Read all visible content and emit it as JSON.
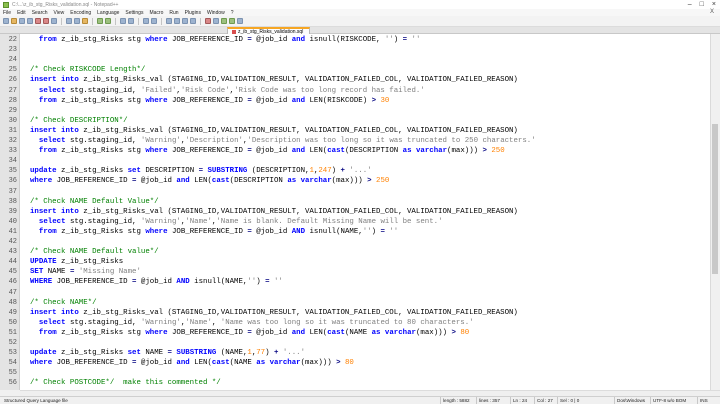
{
  "window": {
    "title": "C:\\...\\z_ib_stg_Risks_validation.sql - Notepad++",
    "minimize": "–",
    "maximize": "□",
    "close": "×"
  },
  "menu": [
    "File",
    "Edit",
    "Search",
    "View",
    "Encoding",
    "Language",
    "Settings",
    "Macro",
    "Run",
    "Plugins",
    "Window",
    "?"
  ],
  "menu_close": "X",
  "tab": {
    "label": "z_ib_stg_Risks_validation.sql"
  },
  "editor": {
    "lines": [
      {
        "n": "22",
        "html": "<span class=\"kw\">from</span> z_ib_stg_Risks stg <span class=\"kw\">where</span> JOB_REFERENCE_ID <span class=\"op\">=</span> @job_id <span class=\"kw\">and</span> isnull(RISKCODE, <span class=\"st\">''</span>) <span class=\"op\">=</span> <span class=\"st\">''</span>",
        "indent": 1
      },
      {
        "n": "23",
        "html": "",
        "indent": 0
      },
      {
        "n": "24",
        "html": "",
        "indent": 0
      },
      {
        "n": "25",
        "html": "<span class=\"cm\">/* Check RISKCODE Length*/</span>",
        "indent": 0
      },
      {
        "n": "26",
        "html": "<span class=\"kw\">insert into</span> z_ib_stg_Risks_val (STAGING_ID,VALIDATION_RESULT, VALIDATION_FAILED_COL, VALIDATION_FAILED_REASON)",
        "indent": 0
      },
      {
        "n": "27",
        "html": "<span class=\"kw\">select</span> stg.staging_id, <span class=\"st\">'Failed'</span>,<span class=\"st\">'Risk Code'</span>,<span class=\"st\">'Risk Code was too long record has failed.'</span>",
        "indent": 1
      },
      {
        "n": "28",
        "html": "<span class=\"kw\">from</span> z_ib_stg_Risks stg <span class=\"kw\">where</span> JOB_REFERENCE_ID <span class=\"op\">=</span> @job_id <span class=\"kw\">and</span> LEN(RISKCODE) <span class=\"op\">&gt;</span> <span class=\"nm\">30</span>",
        "indent": 1
      },
      {
        "n": "29",
        "html": "",
        "indent": 0
      },
      {
        "n": "30",
        "html": "<span class=\"cm\">/* Check DESCRIPTION*/</span>",
        "indent": 0
      },
      {
        "n": "31",
        "html": "<span class=\"kw\">insert into</span> z_ib_stg_Risks_val (STAGING_ID,VALIDATION_RESULT, VALIDATION_FAILED_COL, VALIDATION_FAILED_REASON)",
        "indent": 0
      },
      {
        "n": "32",
        "html": "<span class=\"kw\">select</span> stg.staging_id, <span class=\"st\">'Warning'</span>,<span class=\"st\">'Description'</span>,<span class=\"st\">'Description was too long so it was truncated to 250 characters.'</span>",
        "indent": 1
      },
      {
        "n": "33",
        "html": "<span class=\"kw\">from</span> z_ib_stg_Risks stg <span class=\"kw\">where</span> JOB_REFERENCE_ID <span class=\"op\">=</span> @job_id <span class=\"kw\">and</span> LEN(<span class=\"kw\">cast</span>(DESCRIPTION <span class=\"kw\">as varchar</span>(max))) <span class=\"op\">&gt;</span> <span class=\"nm\">250</span>",
        "indent": 1
      },
      {
        "n": "34",
        "html": "",
        "indent": 0
      },
      {
        "n": "35",
        "html": "<span class=\"kw\">update</span> z_ib_stg_Risks <span class=\"kw\">set</span> DESCRIPTION <span class=\"op\">=</span> <span class=\"kw\">SUBSTRING</span> (DESCRIPTION,<span class=\"nm\">1</span>,<span class=\"nm\">247</span>) <span class=\"op\">+</span> <span class=\"st\">'...'</span>",
        "indent": 0
      },
      {
        "n": "36",
        "html": "<span class=\"kw\">where</span> JOB_REFERENCE_ID <span class=\"op\">=</span> @job_id <span class=\"kw\">and</span> LEN(<span class=\"kw\">cast</span>(DESCRIPTION <span class=\"kw\">as varchar</span>(max))) <span class=\"op\">&gt;</span> <span class=\"nm\">250</span>",
        "indent": 0
      },
      {
        "n": "37",
        "html": "",
        "indent": 0
      },
      {
        "n": "38",
        "html": "<span class=\"cm\">/* Check NAME Default Value*/</span>",
        "indent": 0
      },
      {
        "n": "39",
        "html": "<span class=\"kw\">insert into</span> z_ib_stg_Risks_val (STAGING_ID,VALIDATION_RESULT, VALIDATION_FAILED_COL, VALIDATION_FAILED_REASON)",
        "indent": 0
      },
      {
        "n": "40",
        "html": "<span class=\"kw\">select</span> stg.staging_id, <span class=\"st\">'Warning'</span>,<span class=\"st\">'Name'</span>,<span class=\"st\">'Name is blank. Default Missing Name will be sent.'</span>",
        "indent": 1
      },
      {
        "n": "41",
        "html": "<span class=\"kw\">from</span> z_ib_stg_Risks stg <span class=\"kw\">where</span> JOB_REFERENCE_ID <span class=\"op\">=</span> @job_id <span class=\"kw\">AND</span> isnull(NAME,<span class=\"st\">''</span>) <span class=\"op\">=</span> <span class=\"st\">''</span>",
        "indent": 1
      },
      {
        "n": "42",
        "html": "",
        "indent": 0
      },
      {
        "n": "43",
        "html": "<span class=\"cm\">/* Check NAME Default value*/</span>",
        "indent": 0
      },
      {
        "n": "44",
        "html": "<span class=\"kw\">UPDATE</span> z_ib_stg_Risks",
        "indent": 0
      },
      {
        "n": "45",
        "html": "<span class=\"kw\">SET</span> NAME <span class=\"op\">=</span> <span class=\"st\">'Missing Name'</span>",
        "indent": 0
      },
      {
        "n": "46",
        "html": "<span class=\"kw\">WHERE</span> JOB_REFERENCE_ID <span class=\"op\">=</span> @job_id <span class=\"kw\">AND</span> isnull(NAME,<span class=\"st\">''</span>) <span class=\"op\">=</span> <span class=\"st\">''</span>",
        "indent": 0
      },
      {
        "n": "47",
        "html": "",
        "indent": 0
      },
      {
        "n": "48",
        "html": "<span class=\"cm\">/* Check NAME*/</span>",
        "indent": 0
      },
      {
        "n": "49",
        "html": "<span class=\"kw\">insert into</span> z_ib_stg_Risks_val (STAGING_ID,VALIDATION_RESULT, VALIDATION_FAILED_COL, VALIDATION_FAILED_REASON)",
        "indent": 0
      },
      {
        "n": "50",
        "html": "<span class=\"kw\">select</span> stg.staging_id, <span class=\"st\">'Warning'</span>,<span class=\"st\">'Name'</span>, <span class=\"st\">'Name was too long so it was truncated to 80 characters.'</span>",
        "indent": 1
      },
      {
        "n": "51",
        "html": "<span class=\"kw\">from</span> z_ib_stg_Risks stg <span class=\"kw\">where</span> JOB_REFERENCE_ID <span class=\"op\">=</span> @job_id <span class=\"kw\">and</span> LEN(<span class=\"kw\">cast</span>(NAME <span class=\"kw\">as varchar</span>(max))) <span class=\"op\">&gt;</span> <span class=\"nm\">80</span>",
        "indent": 1
      },
      {
        "n": "52",
        "html": "",
        "indent": 0
      },
      {
        "n": "53",
        "html": "<span class=\"kw\">update</span> z_ib_stg_Risks <span class=\"kw\">set</span> NAME <span class=\"op\">=</span> <span class=\"kw\">SUBSTRING</span> (NAME,<span class=\"nm\">1</span>,<span class=\"nm\">77</span>) <span class=\"op\">+</span> <span class=\"st\">'...'</span>",
        "indent": 0
      },
      {
        "n": "54",
        "html": "<span class=\"kw\">where</span> JOB_REFERENCE_ID <span class=\"op\">=</span> @job_id <span class=\"kw\">and</span> LEN(<span class=\"kw\">cast</span>(NAME <span class=\"kw\">as varchar</span>(max))) <span class=\"op\">&gt;</span> <span class=\"nm\">80</span>",
        "indent": 0
      },
      {
        "n": "55",
        "html": "",
        "indent": 0
      },
      {
        "n": "56",
        "html": "<span class=\"cm\">/* Check POSTCODE*/  make this commented */</span>",
        "indent": 0
      }
    ]
  },
  "status": {
    "file_type": "Structured Query Language file",
    "length": "length : 5882",
    "lines": "lines : 357",
    "ln": "Ln : 24",
    "col": "Col : 27",
    "sel": "Sel : 0 | 0",
    "eol": "Dos\\Windows",
    "encoding": "UTF-8 w/o BOM",
    "mode": "INS"
  }
}
